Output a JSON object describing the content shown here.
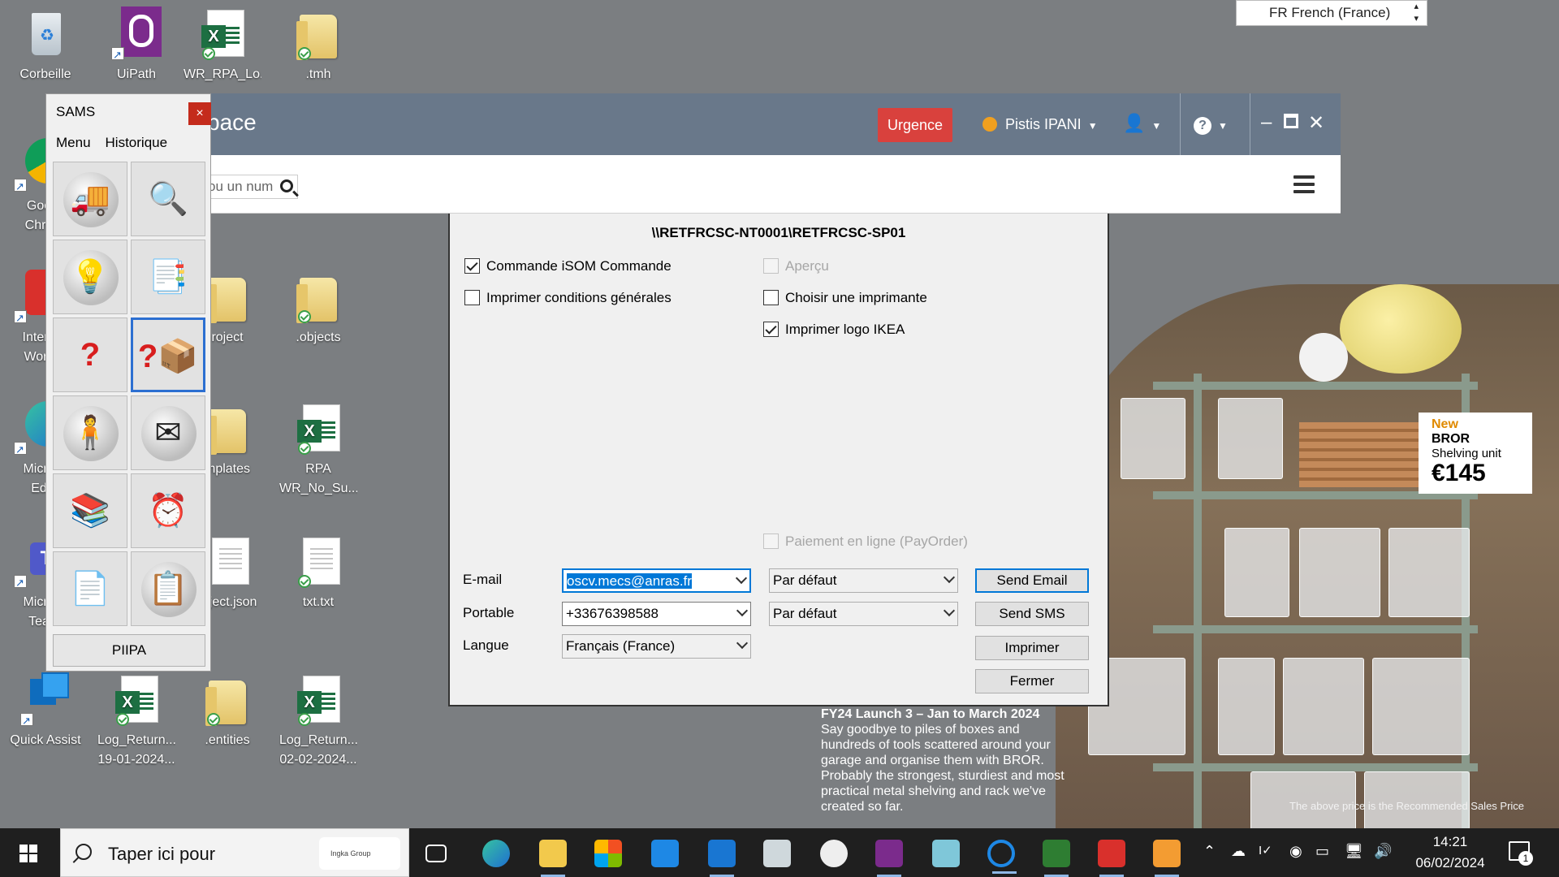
{
  "desktop": {
    "icons": [
      {
        "label": "Corbeille"
      },
      {
        "label": "UiPath"
      },
      {
        "label": "WR_RPA_Lo..."
      },
      {
        "label": ".tmh"
      },
      {
        "label": "Goo\nChro"
      },
      {
        "label": "Intera\nWork"
      },
      {
        "label": "Micro\nEd"
      },
      {
        "label": "Micro\nTea"
      },
      {
        "label": "Quick Assist"
      },
      {
        "label": "Log_Return...\n19-01-2024..."
      },
      {
        "label": ".entities"
      },
      {
        "label": "Log_Return...\n02-02-2024..."
      },
      {
        "label": "roject"
      },
      {
        "label": ".objects"
      },
      {
        "label": "mplates"
      },
      {
        "label": "RPA\nWR_No_Su..."
      },
      {
        "label": "roject.json"
      },
      {
        "label": "txt.txt"
      }
    ]
  },
  "language_bar": {
    "label": "FR French (France)"
  },
  "app": {
    "title": "pace",
    "urgence_label": "Urgence",
    "user_name": "Pistis IPANI",
    "search_placeholder": "ou un num"
  },
  "dialog": {
    "printer_path": "\\\\RETFRCSC-NT0001\\RETFRCSC-SP01",
    "checkboxes": {
      "commande": {
        "label": "Commande iSOM Commande",
        "checked": true
      },
      "conditions": {
        "label": "Imprimer conditions générales",
        "checked": false
      },
      "apercu": {
        "label": "Aperçu",
        "checked": false,
        "disabled": true
      },
      "choisir": {
        "label": "Choisir une imprimante",
        "checked": false
      },
      "logo": {
        "label": "Imprimer logo IKEA",
        "checked": true
      },
      "paiement": {
        "label": "Paiement en ligne (PayOrder)",
        "checked": false,
        "disabled": true
      }
    },
    "email_label": "E-mail",
    "email_value": "oscv.mecs@anras.fr",
    "email_option": "Par défaut",
    "portable_label": "Portable",
    "portable_value": "+33676398588",
    "portable_option": "Par défaut",
    "langue_label": "Langue",
    "langue_value": "Français (France)",
    "buttons": {
      "send_email": "Send Email",
      "send_sms": "Send SMS",
      "imprimer": "Imprimer",
      "fermer": "Fermer"
    }
  },
  "sams": {
    "title": "SAMS",
    "close": "×",
    "menu": [
      "Menu",
      "Historique"
    ],
    "piipa_label": "PIIPA"
  },
  "ad": {
    "new_label": "New",
    "product": "BROR",
    "desc": "Shelving unit",
    "price": "€145",
    "headline": "FY24 Launch 3 – Jan to March 2024",
    "body": "Say goodbye to piles of boxes and hundreds of tools scattered around your garage and organise them with BROR. Probably the strongest, sturdiest and most practical metal shelving and rack we've created so far.",
    "footnote": "The above price is the Recommended Sales Price"
  },
  "taskbar": {
    "search_placeholder": "Taper ici pour",
    "search_logo": "Ingka Group",
    "time": "14:21",
    "date": "06/02/2024",
    "notification_count": "1"
  }
}
